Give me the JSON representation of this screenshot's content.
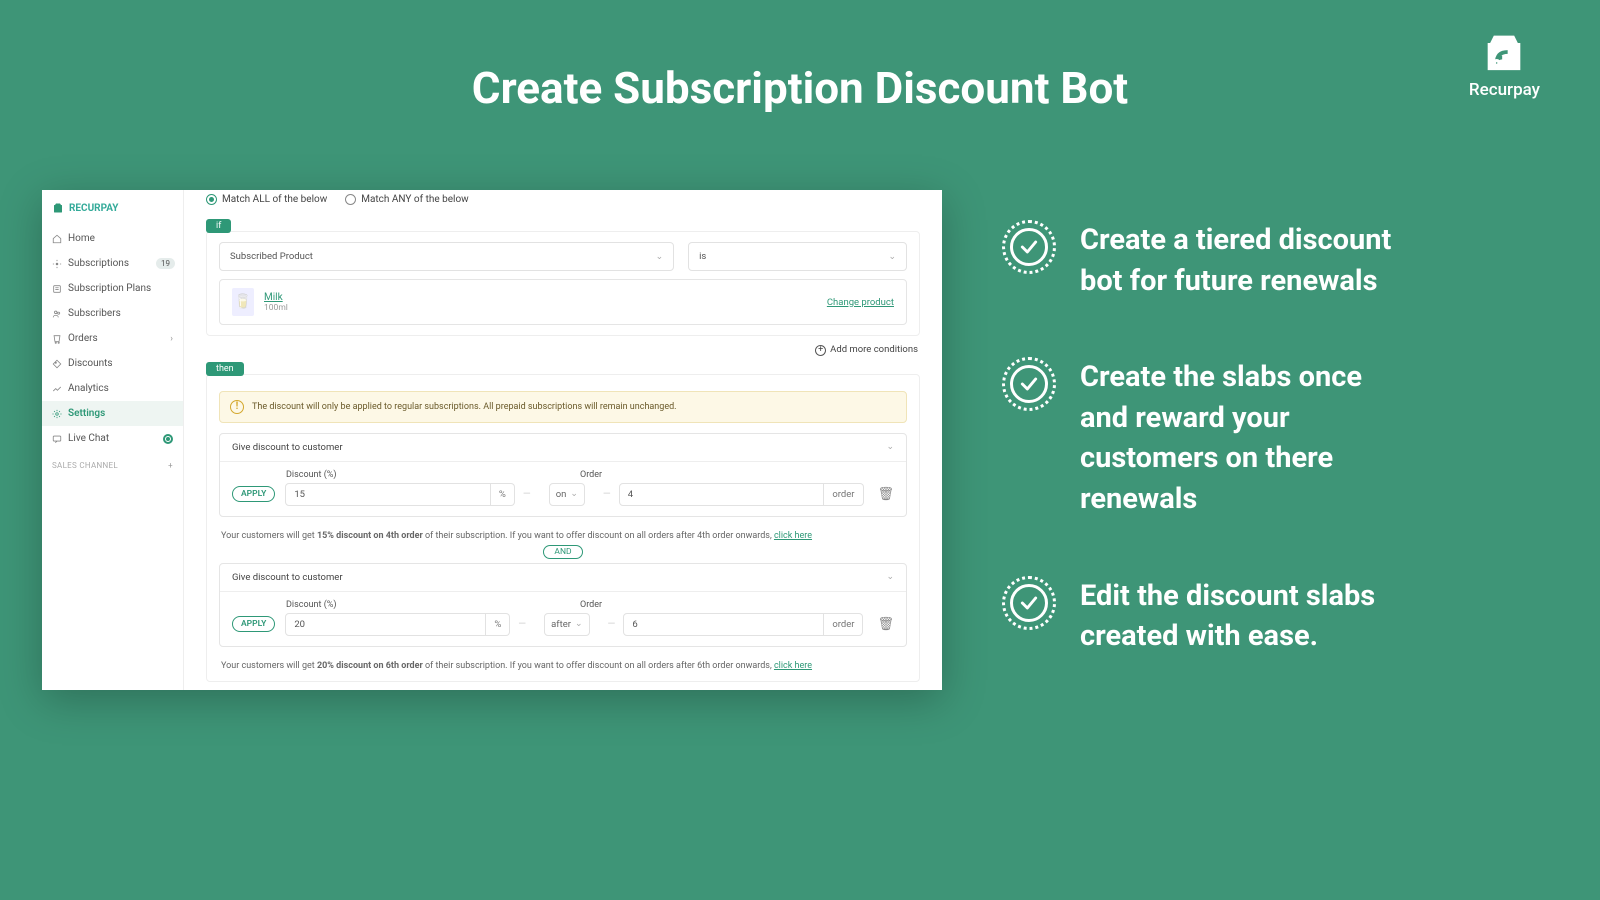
{
  "page": {
    "title": "Create Subscription Discount Bot"
  },
  "brand": {
    "name": "Recurpay"
  },
  "sidebar": {
    "brand": "RECURPAY",
    "items": [
      {
        "label": "Home"
      },
      {
        "label": "Subscriptions",
        "badge": "19"
      },
      {
        "label": "Subscription Plans"
      },
      {
        "label": "Subscribers"
      },
      {
        "label": "Orders",
        "caret": true
      },
      {
        "label": "Discounts"
      },
      {
        "label": "Analytics"
      },
      {
        "label": "Settings",
        "active": true
      },
      {
        "label": "Live Chat",
        "radio": true
      }
    ],
    "section": "SALES CHANNEL"
  },
  "match": {
    "all": "Match ALL of the below",
    "any": "Match ANY of the below",
    "selected": "all"
  },
  "tags": {
    "if": "if",
    "then": "then"
  },
  "condition": {
    "field": "Subscribed Product",
    "op": "is",
    "product": {
      "name": "Milk",
      "variant": "100ml"
    },
    "change": "Change product",
    "addMore": "Add more conditions"
  },
  "alert": {
    "text": "The discount will only be applied to regular subscriptions. All prepaid subscriptions will remain unchanged."
  },
  "blocks": {
    "head": "Give discount to customer",
    "discountLabel": "Discount (%)",
    "orderLabel": "Order",
    "apply": "APPLY",
    "pct": "%",
    "orderSuffix": "order",
    "and": "AND"
  },
  "rows": [
    {
      "discount": "15",
      "mode": "on",
      "order": "4",
      "hintPrefix": "Your customers will get ",
      "hintStrong": "15% discount on 4th order",
      "hintSuffix": " of their subscription. If you want to offer discount on all orders after 4th order onwards, ",
      "hintLink": "click here"
    },
    {
      "discount": "20",
      "mode": "after",
      "order": "6",
      "hintPrefix": "Your customers will get ",
      "hintStrong": "20% discount on 6th order",
      "hintSuffix": " of their subscription. If you want to offer discount on all orders after 6th order onwards, ",
      "hintLink": "click here"
    }
  ],
  "bullets": [
    "Create a tiered discount bot for future renewals",
    "Create the slabs once and reward your customers on there renewals",
    "Edit the discount slabs created with ease."
  ]
}
